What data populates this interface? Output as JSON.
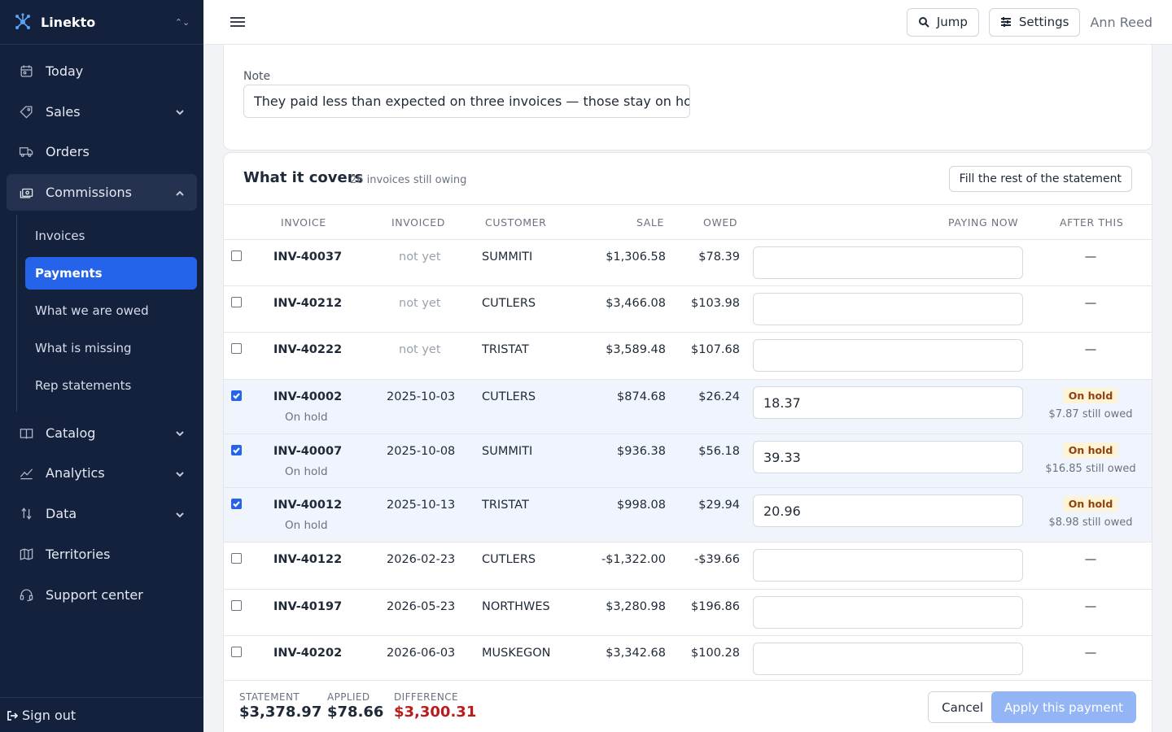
{
  "app": {
    "name": "Linekto"
  },
  "sidebar": {
    "items": [
      {
        "label": "Today",
        "icon": "calendar-icon"
      },
      {
        "label": "Sales",
        "icon": "tag-icon",
        "expandable": true
      },
      {
        "label": "Orders",
        "icon": "truck-icon"
      },
      {
        "label": "Commissions",
        "icon": "cash-icon",
        "expandable": true,
        "expanded": true
      },
      {
        "label": "Catalog",
        "icon": "book-icon",
        "expandable": true
      },
      {
        "label": "Analytics",
        "icon": "chart-line-icon",
        "expandable": true
      },
      {
        "label": "Data",
        "icon": "arrows-sort-icon",
        "expandable": true
      },
      {
        "label": "Territories",
        "icon": "map-icon"
      },
      {
        "label": "Support center",
        "icon": "headset-icon"
      }
    ],
    "sub_items": [
      {
        "label": "Invoices"
      },
      {
        "label": "Payments",
        "active": true
      },
      {
        "label": "What we are owed"
      },
      {
        "label": "What is missing"
      },
      {
        "label": "Rep statements"
      }
    ],
    "sign_out": "Sign out"
  },
  "topbar": {
    "jump_label": "Jump",
    "settings_label": "Settings",
    "user_name": "Ann Reed"
  },
  "note": {
    "label": "Note",
    "value": "They paid less than expected on three invoices — those stay on hold."
  },
  "covers": {
    "title": "What it covers",
    "subtitle": "26 invoices still owing",
    "fill_button": "Fill the rest of the statement",
    "columns": [
      "INVOICE",
      "INVOICED",
      "CUSTOMER",
      "SALE",
      "OWED",
      "PAYING NOW",
      "AFTER THIS"
    ],
    "rows": [
      {
        "invoice": "INV-40037",
        "invoiced": "not yet",
        "customer": "SUMMITI",
        "sale": "$1,306.58",
        "owed": "$78.39",
        "paying": "",
        "checked": false,
        "after": "—"
      },
      {
        "invoice": "INV-40212",
        "invoiced": "not yet",
        "customer": "CUTLERS",
        "sale": "$3,466.08",
        "owed": "$103.98",
        "paying": "",
        "checked": false,
        "after": "—"
      },
      {
        "invoice": "INV-40222",
        "invoiced": "not yet",
        "customer": "TRISTAT",
        "sale": "$3,589.48",
        "owed": "$107.68",
        "paying": "",
        "checked": false,
        "after": "—"
      },
      {
        "invoice": "INV-40002",
        "status": "On hold",
        "invoiced": "2025-10-03",
        "customer": "CUTLERS",
        "sale": "$874.68",
        "owed": "$26.24",
        "paying": "18.37",
        "checked": true,
        "badge": "On hold",
        "still_owed": "$7.87 still owed"
      },
      {
        "invoice": "INV-40007",
        "status": "On hold",
        "invoiced": "2025-10-08",
        "customer": "SUMMITI",
        "sale": "$936.38",
        "owed": "$56.18",
        "paying": "39.33",
        "checked": true,
        "badge": "On hold",
        "still_owed": "$16.85 still owed"
      },
      {
        "invoice": "INV-40012",
        "status": "On hold",
        "invoiced": "2025-10-13",
        "customer": "TRISTAT",
        "sale": "$998.08",
        "owed": "$29.94",
        "paying": "20.96",
        "checked": true,
        "badge": "On hold",
        "still_owed": "$8.98 still owed"
      },
      {
        "invoice": "INV-40122",
        "invoiced": "2026-02-23",
        "customer": "CUTLERS",
        "sale": "-$1,322.00",
        "owed": "-$39.66",
        "paying": "",
        "checked": false,
        "after": "—"
      },
      {
        "invoice": "INV-40197",
        "invoiced": "2026-05-23",
        "customer": "NORTHWES",
        "sale": "$3,280.98",
        "owed": "$196.86",
        "paying": "",
        "checked": false,
        "after": "—"
      },
      {
        "invoice": "INV-40202",
        "invoiced": "2026-06-03",
        "customer": "MUSKEGON",
        "sale": "$3,342.68",
        "owed": "$100.28",
        "paying": "",
        "checked": false,
        "after": "—"
      }
    ]
  },
  "summary": {
    "statement_label": "STATEMENT",
    "statement_value": "$3,378.97",
    "applied_label": "APPLIED",
    "applied_value": "$78.66",
    "difference_label": "DIFFERENCE",
    "difference_value": "$3,300.31",
    "cancel_label": "Cancel",
    "apply_label": "Apply this payment"
  },
  "colors": {
    "sidebar_bg": "#14213d",
    "accent": "#2563eb",
    "danger": "#b91c1c",
    "hold_badge_bg": "#fdf3d7"
  }
}
